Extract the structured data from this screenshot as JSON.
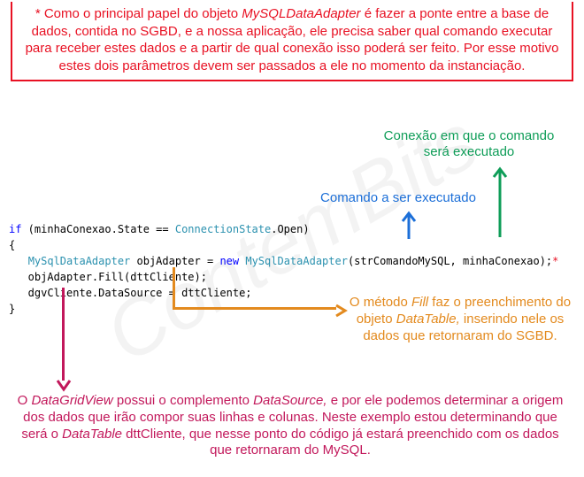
{
  "watermark": "ContemBits",
  "topCallout": {
    "prefix": "* Como o principal papel do objeto ",
    "em1": "MySQLDataAdapter",
    "rest": " é fazer a ponte entre a base de dados, contida no SGBD, e a nossa aplicação, ele precisa saber qual comando executar para receber estes dados e a partir de qual conexão isso poderá ser feito. Por esse motivo estes dois parâmetros devem ser passados a ele no momento da instanciação."
  },
  "greenAnn": "Conexão em que o comando será executado",
  "blueAnn": "Comando a ser executado",
  "code": {
    "l1a": "if",
    "l1b": " (minhaConexao.State == ",
    "l1c": "ConnectionState",
    "l1d": ".Open)",
    "l2": "{",
    "l3a": "   ",
    "l3b": "MySqlDataAdapter",
    "l3c": " objAdapter = ",
    "l3d": "new",
    "l3e": " ",
    "l3f": "MySqlDataAdapter",
    "l3g": "(strComandoMySQL, minhaConexao);",
    "l3h": "*",
    "l4": "   objAdapter.Fill(dttCliente);",
    "l5": "   dgvCliente.DataSource = dttCliente;",
    "l6": "}"
  },
  "orangeAnn": {
    "p1": "O método ",
    "em1": "Fill",
    "p2": " faz o preenchimento do objeto ",
    "em2": "DataTable,",
    "p3": " inserindo nele os dados que retornaram do SGBD."
  },
  "pinkAnn": {
    "p1": "O ",
    "em1": "DataGridView",
    "p2": " possui o complemento ",
    "em2": "DataSource,",
    "p3": " e por ele podemos determinar a origem dos dados que irão compor suas linhas e colunas. Neste exemplo estou determinando que será o ",
    "em3": "DataTable",
    "p4": " dttCliente, que nesse ponto do código já estará preenchido com os dados que retornaram do MySQL."
  },
  "colors": {
    "red": "#e81123",
    "green": "#0f9d58",
    "blue": "#1c6fd8",
    "orange": "#e38a1e",
    "pink": "#c2185b"
  }
}
